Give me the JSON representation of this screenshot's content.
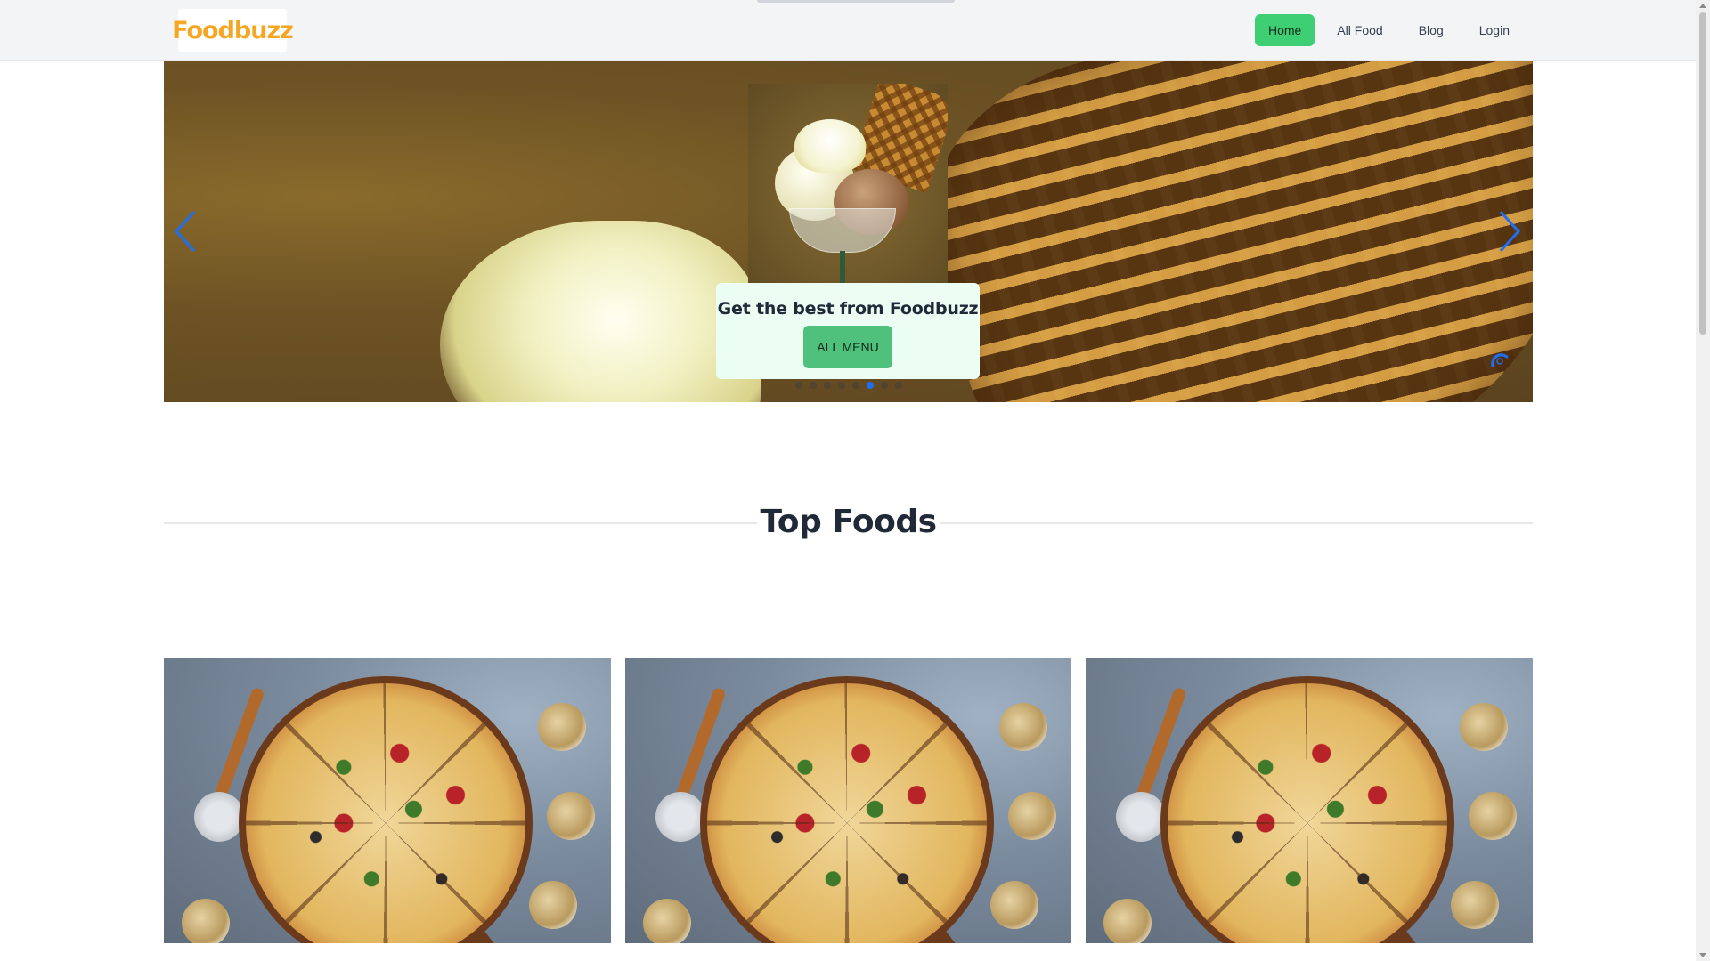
{
  "brand": {
    "logo_text": "Foodbuzz"
  },
  "nav": {
    "items": [
      {
        "label": "Home",
        "active": true
      },
      {
        "label": "All Food",
        "active": false
      },
      {
        "label": "Blog",
        "active": false
      },
      {
        "label": "Login",
        "active": false
      }
    ]
  },
  "hero": {
    "caption_title": "Get the best from Foodbuzz",
    "caption_button": "ALL MENU",
    "slide_count": 8,
    "active_slide": 6
  },
  "section": {
    "title": "Top Foods"
  },
  "cards": [
    {
      "image": "pizza"
    },
    {
      "image": "pizza"
    },
    {
      "image": "pizza"
    }
  ],
  "colors": {
    "accent": "#3ecf75",
    "caption_bg": "#ecfdf3",
    "dot_active": "#1e6ff2",
    "arrow": "#1e6ff2"
  },
  "icons": {
    "prev": "chevron-left-icon",
    "next": "chevron-right-icon",
    "autoplay": "autoplay-icon"
  }
}
